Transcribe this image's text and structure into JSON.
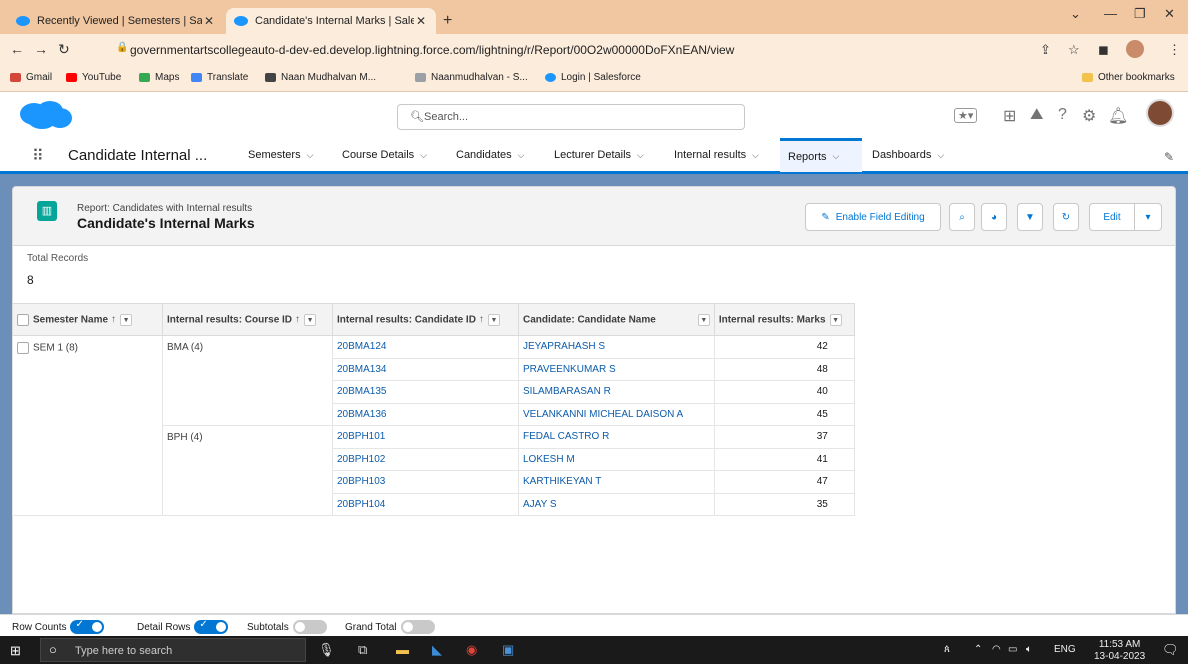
{
  "browser": {
    "tabs": [
      {
        "title": "Recently Viewed | Semesters | Sa"
      },
      {
        "title": "Candidate's Internal Marks | Sale"
      }
    ],
    "url": "governmentartscollegeauto-d-dev-ed.develop.lightning.force.com/lightning/r/Report/00O2w00000DoFXnEAN/view",
    "bookmarks": [
      "Gmail",
      "YouTube",
      "Maps",
      "Translate",
      "Naan Mudhalvan M...",
      "Naanmudhalvan - S...",
      "Login | Salesforce"
    ],
    "other_bookmarks": "Other bookmarks"
  },
  "sf": {
    "search_placeholder": "Search...",
    "app_name": "Candidate Internal ...",
    "nav": [
      "Semesters",
      "Course Details",
      "Candidates",
      "Lecturer Details",
      "Internal results",
      "Reports",
      "Dashboards"
    ],
    "selected_nav": "Reports"
  },
  "report": {
    "subtitle": "Report: Candidates with Internal results",
    "title": "Candidate's Internal Marks",
    "enable_field_editing": "Enable Field Editing",
    "edit": "Edit",
    "total_records_label": "Total Records",
    "total_records": "8",
    "columns": [
      "Semester Name",
      "Internal results: Course ID",
      "Internal results: Candidate ID",
      "Candidate: Candidate Name",
      "Internal results: Marks"
    ],
    "semester_group": "SEM 1 (8)",
    "course_groups": [
      "BMA (4)",
      "BPH (4)"
    ],
    "rows": [
      {
        "id": "20BMA124",
        "name": "JEYAPRAHASH S",
        "marks": "42"
      },
      {
        "id": "20BMA134",
        "name": "PRAVEENKUMAR S",
        "marks": "48"
      },
      {
        "id": "20BMA135",
        "name": "SILAMBARASAN R",
        "marks": "40"
      },
      {
        "id": "20BMA136",
        "name": "VELANKANNI MICHEAL DAISON A",
        "marks": "45"
      },
      {
        "id": "20BPH101",
        "name": "FEDAL CASTRO R",
        "marks": "37"
      },
      {
        "id": "20BPH102",
        "name": "LOKESH M",
        "marks": "41"
      },
      {
        "id": "20BPH103",
        "name": "KARTHIKEYAN T",
        "marks": "47"
      },
      {
        "id": "20BPH104",
        "name": "AJAY S",
        "marks": "35"
      }
    ]
  },
  "footer": {
    "row_counts": "Row Counts",
    "detail_rows": "Detail Rows",
    "subtotals": "Subtotals",
    "grand_total": "Grand Total"
  },
  "taskbar": {
    "search_placeholder": "Type here to search",
    "lang": "ENG",
    "time": "11:53 AM",
    "date": "13-04-2023"
  }
}
